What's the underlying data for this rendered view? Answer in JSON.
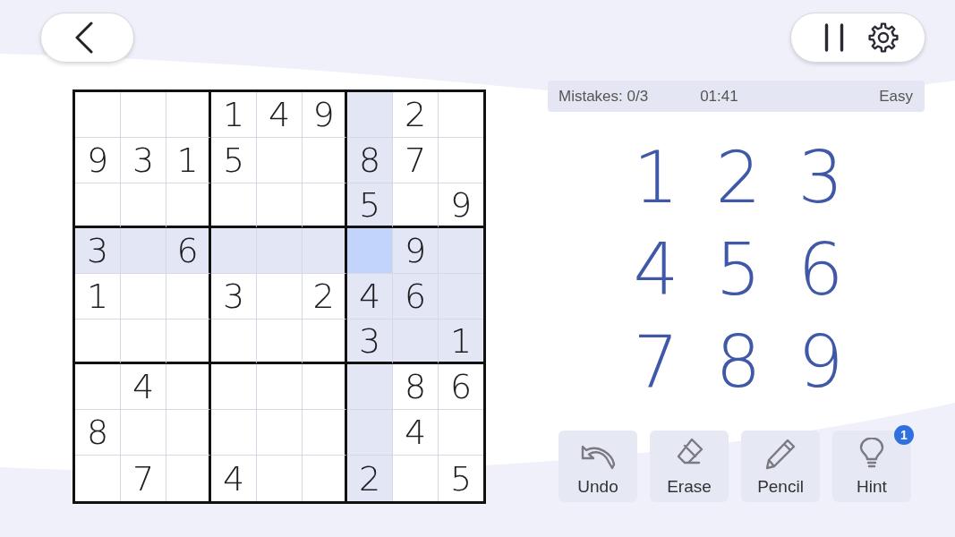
{
  "status_bar": {
    "mistakes": "Mistakes: 0/3",
    "time": "01:41",
    "difficulty": "Easy"
  },
  "board": {
    "rows": [
      {
        "cells": [
          {
            "selected": false
          },
          {
            "selected": false
          },
          {
            "selected": false
          },
          {
            "value": "1",
            "selected": false
          },
          {
            "value": "4",
            "selected": false
          },
          {
            "value": "9",
            "selected": false
          },
          {
            "selected": false
          },
          {
            "value": "2",
            "selected": false
          },
          {
            "selected": false
          }
        ]
      },
      {
        "cells": [
          {
            "value": "9",
            "selected": false
          },
          {
            "value": "3",
            "selected": false
          },
          {
            "value": "1",
            "selected": false
          },
          {
            "value": "5",
            "selected": false
          },
          {
            "selected": false
          },
          {
            "selected": false
          },
          {
            "value": "8",
            "selected": false
          },
          {
            "value": "7",
            "selected": false
          },
          {
            "selected": false
          }
        ]
      },
      {
        "cells": [
          {
            "selected": false
          },
          {
            "selected": false
          },
          {
            "selected": false
          },
          {
            "selected": false
          },
          {
            "selected": false
          },
          {
            "selected": false
          },
          {
            "value": "5",
            "selected": false
          },
          {
            "selected": false
          },
          {
            "value": "9",
            "selected": false
          }
        ]
      },
      {
        "cells": [
          {
            "value": "3",
            "selected": false
          },
          {
            "selected": false
          },
          {
            "value": "6",
            "selected": false
          },
          {
            "selected": false
          },
          {
            "selected": false
          },
          {
            "selected": false
          },
          {
            "selected": true
          },
          {
            "value": "9",
            "selected": false
          },
          {
            "selected": false
          }
        ]
      },
      {
        "cells": [
          {
            "value": "1",
            "selected": false
          },
          {
            "selected": false
          },
          {
            "selected": false
          },
          {
            "value": "3",
            "selected": false
          },
          {
            "selected": false
          },
          {
            "value": "2",
            "selected": false
          },
          {
            "value": "4",
            "selected": false
          },
          {
            "value": "6",
            "selected": false
          },
          {
            "selected": false
          }
        ]
      },
      {
        "cells": [
          {
            "selected": false
          },
          {
            "selected": false
          },
          {
            "selected": false
          },
          {
            "selected": false
          },
          {
            "selected": false
          },
          {
            "selected": false
          },
          {
            "value": "3",
            "selected": false
          },
          {
            "selected": false
          },
          {
            "value": "1",
            "selected": false
          }
        ]
      },
      {
        "cells": [
          {
            "selected": false
          },
          {
            "value": "4",
            "selected": false
          },
          {
            "selected": false
          },
          {
            "selected": false
          },
          {
            "selected": false
          },
          {
            "selected": false
          },
          {
            "selected": false
          },
          {
            "value": "8",
            "selected": false
          },
          {
            "value": "6",
            "selected": false
          }
        ]
      },
      {
        "cells": [
          {
            "value": "8",
            "selected": false
          },
          {
            "selected": false
          },
          {
            "selected": false
          },
          {
            "selected": false
          },
          {
            "selected": false
          },
          {
            "selected": false
          },
          {
            "selected": false
          },
          {
            "value": "4",
            "selected": false
          },
          {
            "selected": false
          }
        ]
      },
      {
        "cells": [
          {
            "selected": false
          },
          {
            "value": "7",
            "selected": false
          },
          {
            "selected": false
          },
          {
            "value": "4",
            "selected": false
          },
          {
            "selected": false
          },
          {
            "selected": false
          },
          {
            "value": "2",
            "selected": false
          },
          {
            "selected": false
          },
          {
            "value": "5",
            "selected": false
          }
        ]
      }
    ]
  },
  "number_pad": {
    "digits": [
      "1",
      "2",
      "3",
      "4",
      "5",
      "6",
      "7",
      "8",
      "9"
    ]
  },
  "actions": [
    {
      "kind": "undo",
      "label": "Undo"
    },
    {
      "kind": "erase",
      "label": "Erase"
    },
    {
      "kind": "pencil",
      "label": "Pencil"
    },
    {
      "kind": "hint",
      "label": "Hint",
      "badge": "1"
    }
  ]
}
